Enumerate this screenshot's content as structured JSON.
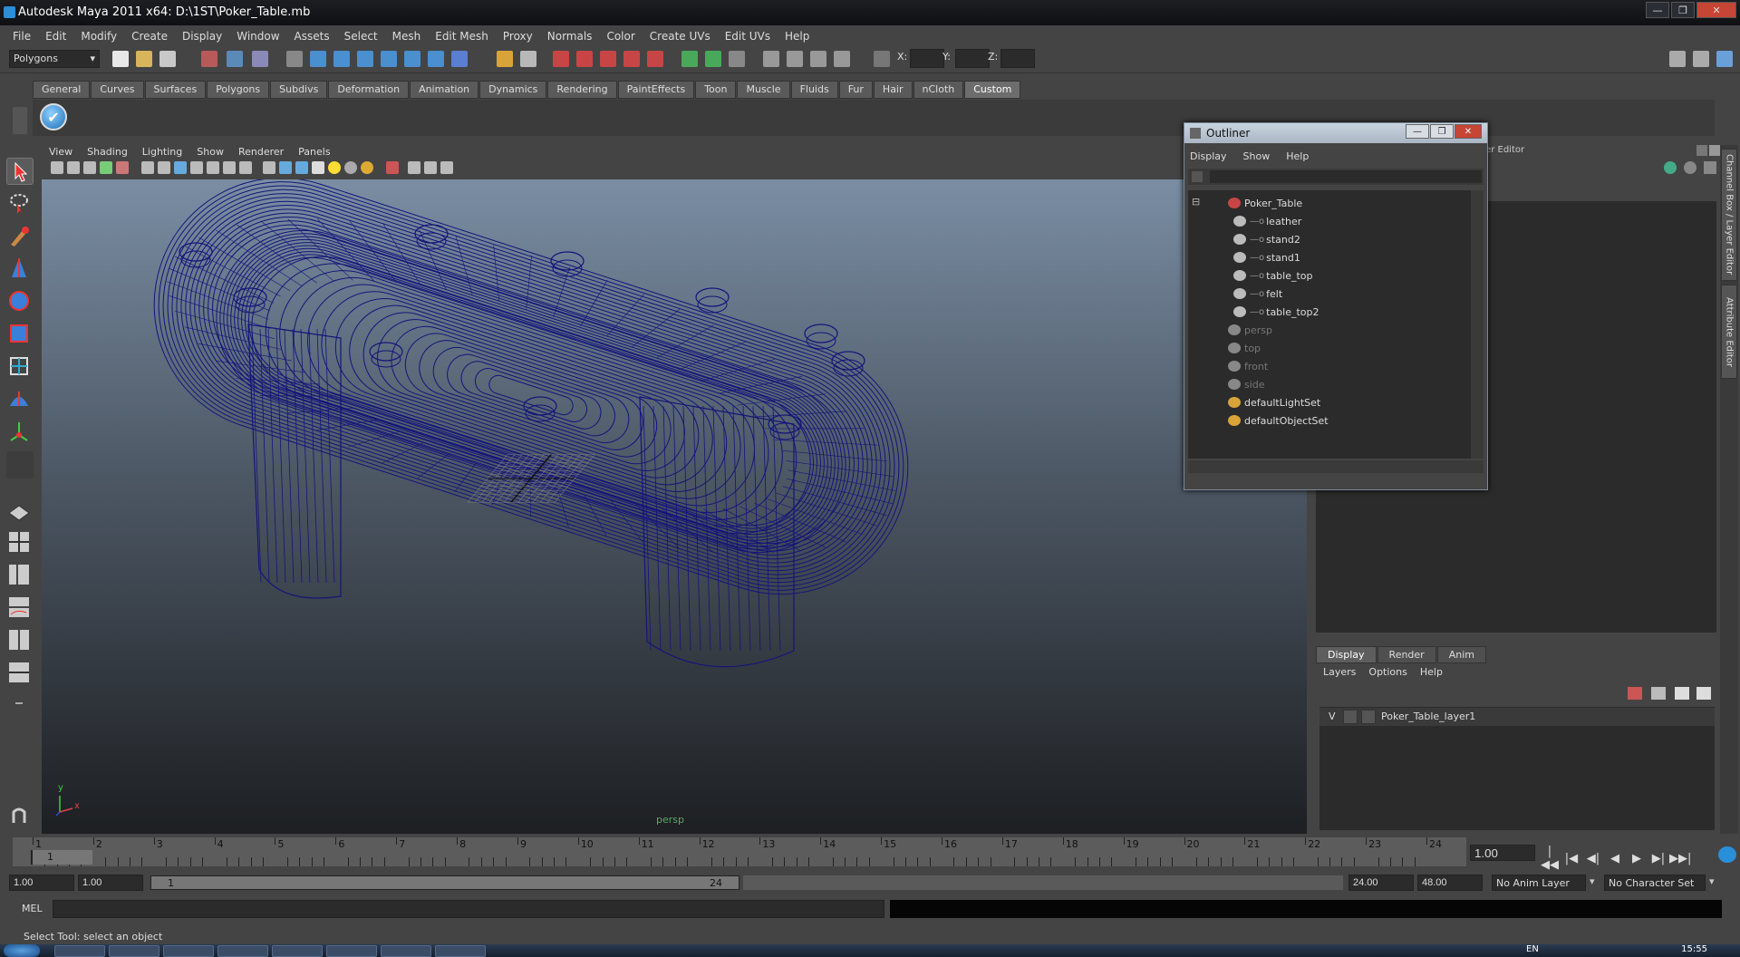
{
  "window": {
    "title": "Autodesk Maya 2011 x64: D:\\1ST\\Poker_Table.mb",
    "buttons": [
      "—",
      "❐",
      "✕"
    ]
  },
  "menubar": [
    "File",
    "Edit",
    "Modify",
    "Create",
    "Display",
    "Window",
    "Assets",
    "Select",
    "Mesh",
    "Edit Mesh",
    "Proxy",
    "Normals",
    "Color",
    "Create UVs",
    "Edit UVs",
    "Help"
  ],
  "status": {
    "mode": "Polygons",
    "x_label": "X:",
    "y_label": "Y:",
    "z_label": "Z:"
  },
  "shelf_tabs": [
    "General",
    "Curves",
    "Surfaces",
    "Polygons",
    "Subdivs",
    "Deformation",
    "Animation",
    "Dynamics",
    "Rendering",
    "PaintEffects",
    "Toon",
    "Muscle",
    "Fluids",
    "Fur",
    "Hair",
    "nCloth",
    "Custom"
  ],
  "shelf_active": "Custom",
  "viewport": {
    "menu": [
      "View",
      "Shading",
      "Lighting",
      "Show",
      "Renderer",
      "Panels"
    ],
    "camera_label": "persp",
    "axis_y": "y",
    "axis_x": "x"
  },
  "outliner": {
    "title": "Outliner",
    "menu": [
      "Display",
      "Show",
      "Help"
    ],
    "items": [
      {
        "label": "Poker_Table",
        "level": 0,
        "dim": false,
        "kind": "group"
      },
      {
        "label": "leather",
        "level": 1,
        "dim": false,
        "kind": "mesh"
      },
      {
        "label": "stand2",
        "level": 1,
        "dim": false,
        "kind": "mesh"
      },
      {
        "label": "stand1",
        "level": 1,
        "dim": false,
        "kind": "mesh"
      },
      {
        "label": "table_top",
        "level": 1,
        "dim": false,
        "kind": "mesh"
      },
      {
        "label": "felt",
        "level": 1,
        "dim": false,
        "kind": "mesh"
      },
      {
        "label": "table_top2",
        "level": 1,
        "dim": false,
        "kind": "mesh"
      },
      {
        "label": "persp",
        "level": 0,
        "dim": true,
        "kind": "camera"
      },
      {
        "label": "top",
        "level": 0,
        "dim": true,
        "kind": "camera"
      },
      {
        "label": "front",
        "level": 0,
        "dim": true,
        "kind": "camera"
      },
      {
        "label": "side",
        "level": 0,
        "dim": true,
        "kind": "camera"
      },
      {
        "label": "defaultLightSet",
        "level": 0,
        "dim": false,
        "kind": "set"
      },
      {
        "label": "defaultObjectSet",
        "level": 0,
        "dim": false,
        "kind": "set"
      }
    ]
  },
  "channel_box": {
    "header": "ox / Layer Editor",
    "side_tabs": [
      "Channel Box / Layer Editor",
      "Attribute Editor"
    ]
  },
  "layer_editor": {
    "tabs": [
      "Display",
      "Render",
      "Anim"
    ],
    "active_tab": "Display",
    "menu": [
      "Layers",
      "Options",
      "Help"
    ],
    "layer": {
      "visible": "V",
      "name": "Poker_Table_layer1"
    }
  },
  "time_slider": {
    "ticks": [
      "1",
      "2",
      "3",
      "4",
      "5",
      "6",
      "7",
      "8",
      "9",
      "10",
      "11",
      "12",
      "13",
      "14",
      "15",
      "16",
      "17",
      "18",
      "19",
      "20",
      "21",
      "22",
      "23",
      "24"
    ],
    "current": "1",
    "current_field": "1.00",
    "playback": [
      "|◀◀",
      "|◀",
      "◀|",
      "◀",
      "▶",
      "▶|",
      "▶▶|"
    ]
  },
  "range": {
    "start": "1.00",
    "playback_start": "1.00",
    "slider_start": "1",
    "slider_end": "24",
    "playback_end": "24.00",
    "end": "48.00",
    "anim_layer": "No Anim Layer",
    "char_set": "No Character Set"
  },
  "command": {
    "label": "MEL",
    "help": "Select Tool: select an object"
  },
  "taskbar": {
    "clock": "15:55",
    "lang": "EN"
  },
  "colors": {
    "wire": "#14147a",
    "accent": "#2a8fd9",
    "close": "#c64535"
  }
}
